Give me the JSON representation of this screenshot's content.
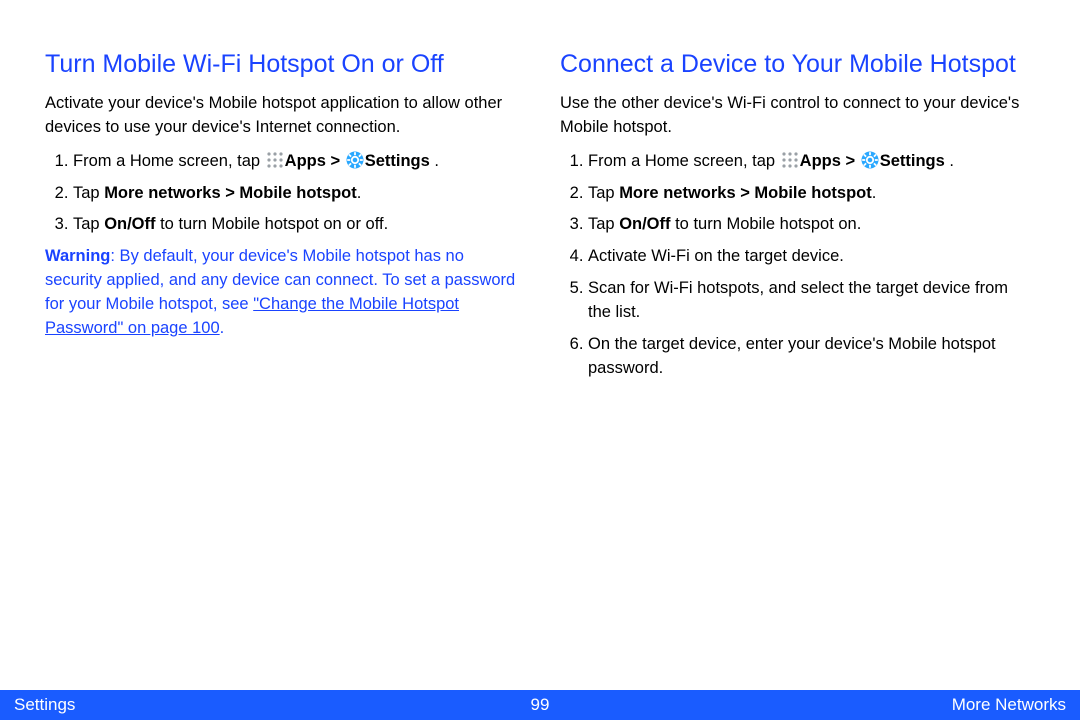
{
  "left": {
    "heading": "Turn Mobile Wi-Fi Hotspot On or Off",
    "intro": "Activate your device's Mobile hotspot application to allow other devices to use your device's Internet connection.",
    "step1_pre": "From a Home screen, tap ",
    "step1_apps": "Apps > ",
    "step1_settings": "Settings",
    "step1_post": " .",
    "step2_pre": "Tap ",
    "step2_bold": "More networks > Mobile hotspot",
    "step2_post": ".",
    "step3_pre": "Tap ",
    "step3_bold": "On/Off",
    "step3_post": " to turn Mobile hotspot on or off.",
    "warning_label": "Warning",
    "warning_text_pre": ": By default, your device's Mobile hotspot has no security applied, and any device can connect. To set a password for your Mobile hotspot, see ",
    "warning_link": "\"Change the Mobile Hotspot Password\" on page 100",
    "warning_text_post": "."
  },
  "right": {
    "heading": "Connect a Device to Your Mobile Hotspot",
    "intro": "Use the other device's Wi-Fi control to connect to your device's Mobile hotspot.",
    "step1_pre": "From a Home screen, tap ",
    "step1_apps": "Apps > ",
    "step1_settings": "Settings",
    "step1_post": " .",
    "step2_pre": "Tap ",
    "step2_bold": "More networks > Mobile hotspot",
    "step2_post": ".",
    "step3_pre": "Tap ",
    "step3_bold": "On/Off",
    "step3_post": " to turn Mobile hotspot on.",
    "step4": "Activate Wi-Fi on the target device.",
    "step5": "Scan for Wi-Fi hotspots, and select the target device from the list.",
    "step6": "On the target device, enter your device's Mobile hotspot password."
  },
  "footer": {
    "left": "Settings",
    "center": "99",
    "right": "More Networks"
  }
}
